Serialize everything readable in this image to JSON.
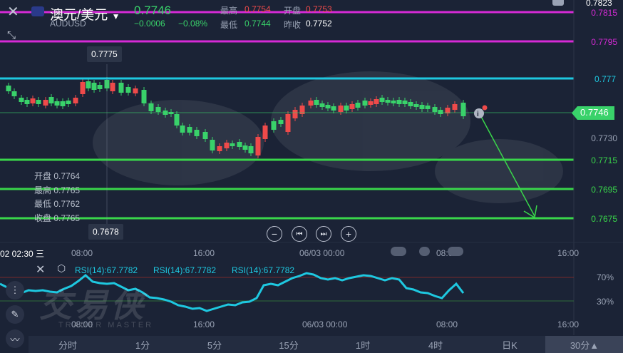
{
  "header": {
    "title": "澳元/美元",
    "symbol": "AUDUSD",
    "price": "0.7746",
    "change": "−0.0006",
    "change_pct": "−0.08%",
    "high_label": "最高",
    "high_value": "0.7754",
    "open_label": "开盘",
    "open_value": "0.7753",
    "low_label": "最低",
    "low_value": "0.7744",
    "prev_label": "昨收",
    "prev_value": "0.7752"
  },
  "price_axis": {
    "top": "0.7823",
    "levels": [
      {
        "price": "0.7815",
        "color": "#d62ad6"
      },
      {
        "price": "0.7795",
        "color": "#d62ad6"
      },
      {
        "price": "0.777",
        "color": "#1ec8e0"
      },
      {
        "price": "0.7715",
        "color": "#39d64a"
      },
      {
        "price": "0.7695",
        "color": "#39d64a"
      },
      {
        "price": "0.7675",
        "color": "#39d64a"
      }
    ],
    "current": "0.7746",
    "tick": "0.7730"
  },
  "tooltip": {
    "high_marker": "0.7775",
    "low_marker": "0.7678"
  },
  "ohlc_box": {
    "open": "开盘 0.7764",
    "high": "最高 0.7765",
    "low": "最低 0.7762",
    "close": "收盘 0.7765"
  },
  "time_axis": {
    "cursor": "02 02:30 三",
    "labels": [
      "08:00",
      "16:00",
      "06/03 00:00",
      "08:00",
      "16:00"
    ]
  },
  "rsi": {
    "labels": [
      "RSI(14):67.7782",
      "RSI(14):67.7782",
      "RSI(14):67.7782"
    ],
    "level_high": "70%",
    "level_low": "30%",
    "time_labels": [
      "08:00",
      "16:00",
      "06/03 00:00",
      "08:00",
      "16:00"
    ]
  },
  "watermark": {
    "text": "交易侠",
    "sub": "TRADER MASTER"
  },
  "tabs": [
    "分时",
    "1分",
    "5分",
    "15分",
    "1时",
    "4时",
    "日K",
    "30分▲"
  ],
  "colors": {
    "up": "#ef4a4a",
    "down": "#39d26a",
    "background": "#1b2336",
    "rsi": "#1ec8e0"
  }
}
